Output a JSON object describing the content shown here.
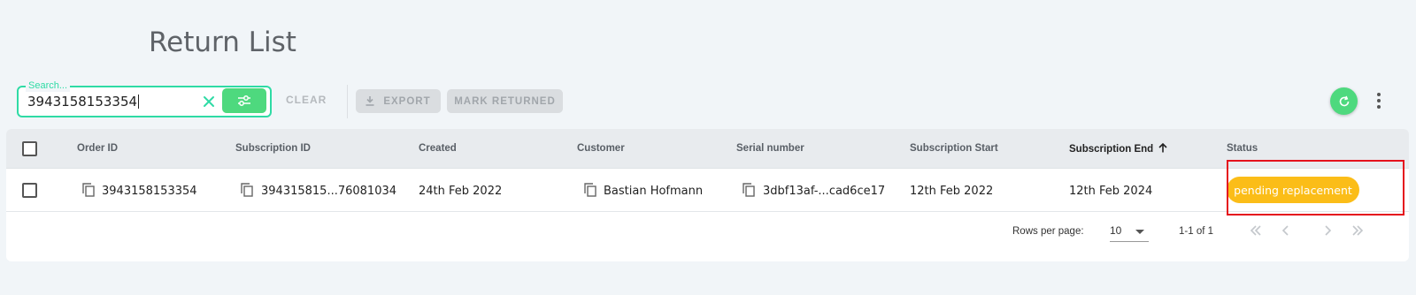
{
  "page": {
    "title": "Return List"
  },
  "toolbar": {
    "search": {
      "legend": "Search...",
      "value": "3943158153354"
    },
    "clear_label": "CLEAR",
    "export_label": "EXPORT",
    "mark_returned_label": "MARK RETURNED"
  },
  "table": {
    "columns": [
      "Order ID",
      "Subscription ID",
      "Created",
      "Customer",
      "Serial number",
      "Subscription Start",
      "Subscription End",
      "Status"
    ],
    "sorted_column": "Subscription End",
    "sort_direction": "ascending",
    "rows": [
      {
        "order_id": "3943158153354",
        "subscription_id": "394315815...76081034",
        "created": "24th Feb 2022",
        "customer": "Bastian Hofmann",
        "serial_number": "3dbf13af-...cad6ce17",
        "subscription_start": "12th Feb 2022",
        "subscription_end": "12th Feb 2024",
        "status": "pending replacement"
      }
    ]
  },
  "pagination": {
    "rows_per_page_label": "Rows per page:",
    "rows_per_page": "10",
    "range": "1-1 of 1"
  },
  "colors": {
    "accent_green": "#4ed97e",
    "search_border": "#2fdba5",
    "status_pending": "#fbbd18",
    "highlight": "#e5121d"
  }
}
